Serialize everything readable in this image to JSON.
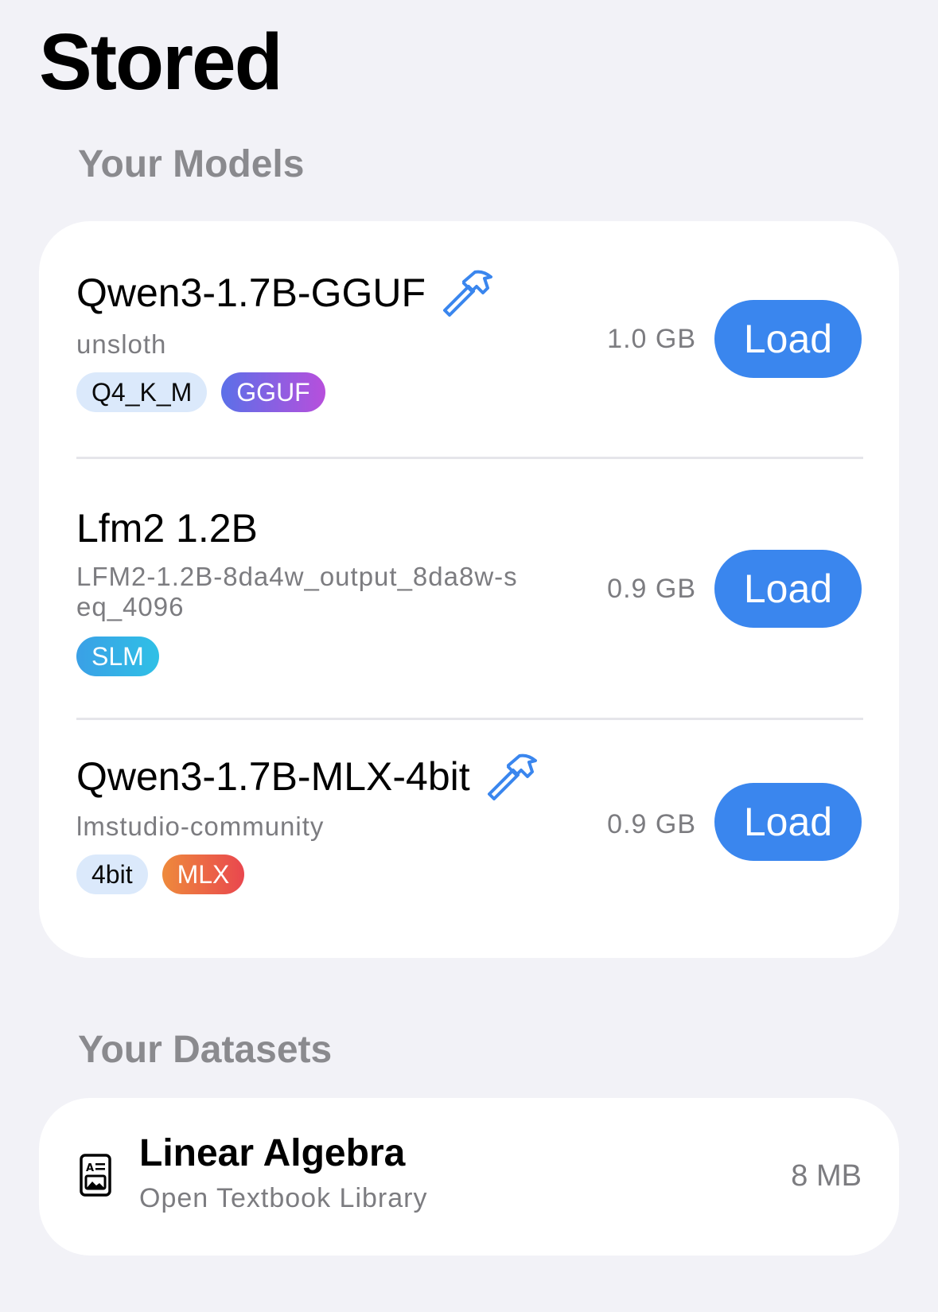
{
  "page": {
    "title": "Stored"
  },
  "models_section": {
    "header": "Your Models",
    "items": [
      {
        "name": "Qwen3-1.7B-GGUF",
        "has_hammer_icon": true,
        "author": "unsloth",
        "tags": [
          "Q4_K_M",
          "GGUF"
        ],
        "size": "1.0 GB",
        "action": "Load"
      },
      {
        "name": "Lfm2 1.2B",
        "has_hammer_icon": false,
        "author": "LFM2-1.2B-8da4w_output_8da8w-seq_4096",
        "tags": [
          "SLM"
        ],
        "size": "0.9 GB",
        "action": "Load"
      },
      {
        "name": "Qwen3-1.7B-MLX-4bit",
        "has_hammer_icon": true,
        "author": "lmstudio-community",
        "tags": [
          "4bit",
          "MLX"
        ],
        "size": "0.9 GB",
        "action": "Load"
      }
    ]
  },
  "datasets_section": {
    "header": "Your Datasets",
    "items": [
      {
        "icon": "document-icon",
        "name": "Linear Algebra",
        "source": "Open Textbook Library",
        "size": "8 MB"
      }
    ]
  },
  "colors": {
    "background": "#f2f2f7",
    "card": "#ffffff",
    "accent": "#3a86ee",
    "secondary_text": "#7c7c80",
    "section_header": "#8a8a8e"
  }
}
